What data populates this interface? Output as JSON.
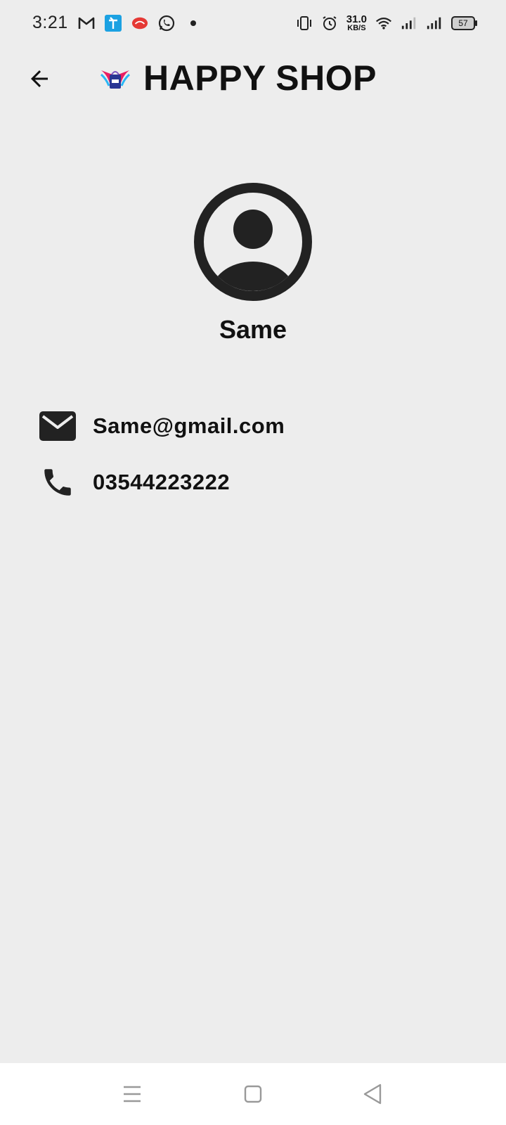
{
  "status_bar": {
    "time": "3:21",
    "net_speed_value": "31.0",
    "net_speed_unit": "KB/S",
    "battery": "57",
    "left_icons": [
      "gmail-icon",
      "telenor-icon",
      "jazz-icon",
      "whatsapp-icon",
      "dot-icon"
    ],
    "right_icons": [
      "vibrate-icon",
      "alarm-icon",
      "wifi-icon",
      "signal-icon",
      "signal-icon-2",
      "battery-icon"
    ]
  },
  "app_bar": {
    "title": "HAPPY SHOP",
    "back_icon": "arrow-back-icon",
    "logo": "shop-logo"
  },
  "profile": {
    "name": "Same",
    "email": "Same@gmail.com",
    "phone": "03544223222",
    "avatar_icon": "account-circle-icon",
    "email_icon": "email-icon",
    "phone_icon": "phone-icon"
  },
  "nav_bar": {
    "icons": [
      "menu-icon",
      "home-icon",
      "back-triangle-icon"
    ]
  },
  "colors": {
    "background": "#ededed",
    "text": "#111111",
    "icon": "#222222",
    "nav_bar": "#ffffff"
  }
}
